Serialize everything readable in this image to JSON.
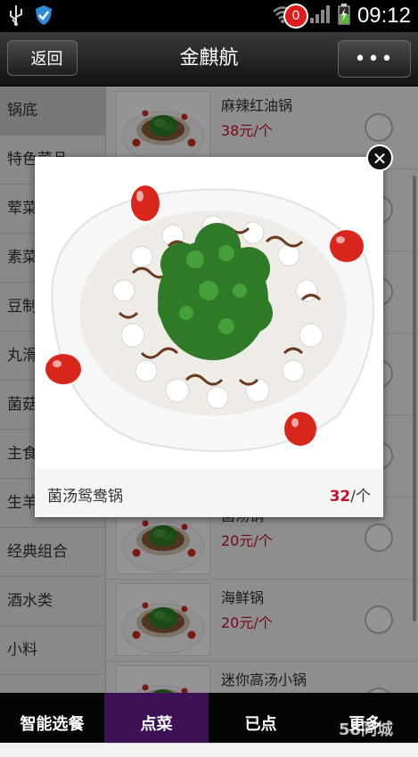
{
  "status_bar": {
    "time": "09:12",
    "network": "E"
  },
  "header": {
    "back_label": "返回",
    "title": "金麒航",
    "more_label": "•••"
  },
  "sidebar": {
    "categories": [
      "锅底",
      "特色菜品",
      "荤菜",
      "素菜",
      "豆制品",
      "丸滑",
      "菌菇",
      "主食",
      "生羊",
      "经典组合",
      "酒水类",
      "小料"
    ]
  },
  "menu": {
    "items": [
      {
        "name": "麻辣红油锅",
        "price": "38元/个"
      },
      {
        "name": "",
        "price": ""
      },
      {
        "name": "",
        "price": ""
      },
      {
        "name": "",
        "price": ""
      },
      {
        "name": "",
        "price": ""
      },
      {
        "name": "菌汤锅",
        "price": "20元/个"
      },
      {
        "name": "海鲜锅",
        "price": "20元/个"
      },
      {
        "name": "迷你高汤小锅",
        "price": ""
      }
    ]
  },
  "popup": {
    "name": "菌汤鸳鸯锅",
    "price_number": "32",
    "price_unit": "/个",
    "close_label": "✕"
  },
  "tabbar": {
    "tabs": [
      "智能选餐",
      "点菜",
      "已点",
      "更多"
    ],
    "active": "点菜",
    "badge": "0"
  },
  "watermark": "58同城"
}
